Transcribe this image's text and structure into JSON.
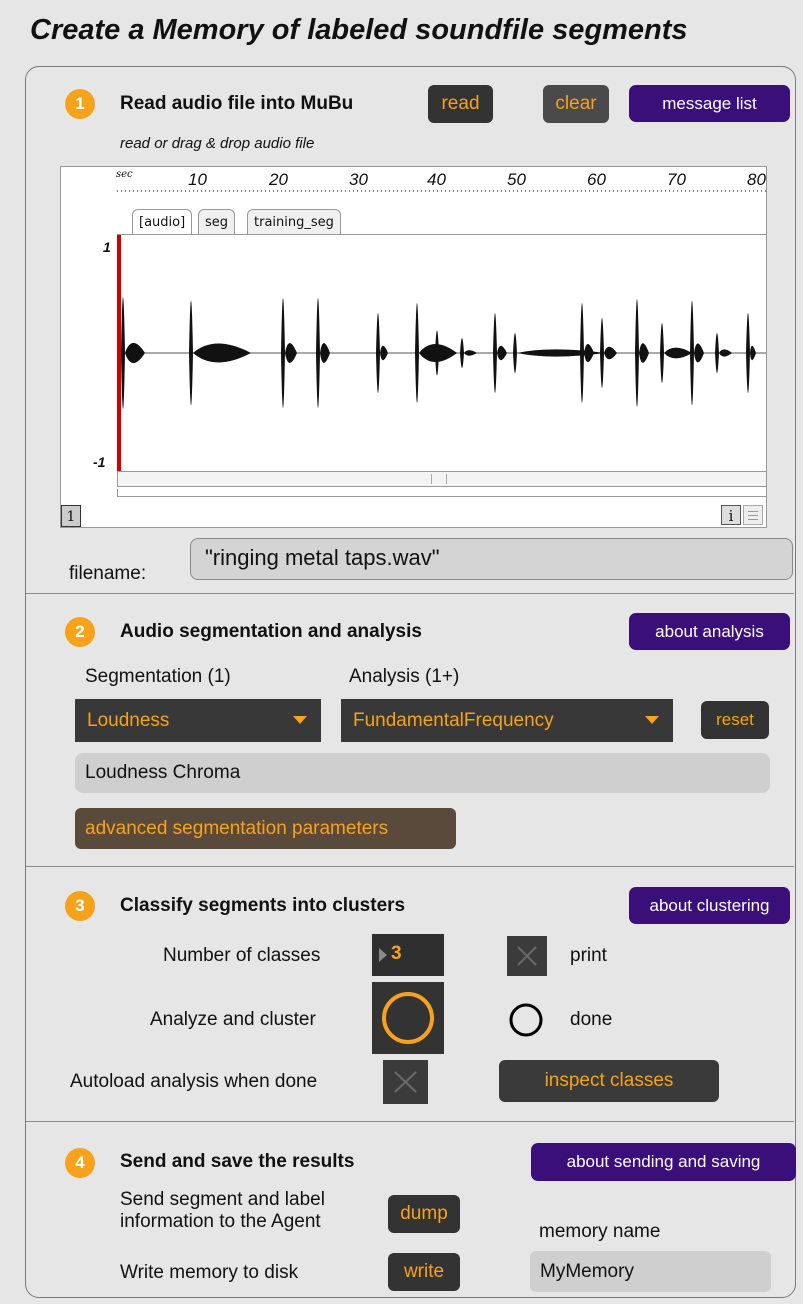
{
  "title": "Create a Memory of labeled soundfile segments",
  "section1": {
    "number": "1",
    "title": "Read audio file into MuBu",
    "read_label": "read",
    "clear_label": "clear",
    "message_list_label": "message list",
    "hint": "read or drag & drop audio file",
    "ruler_unit": "sec",
    "ruler_ticks": [
      "10",
      "20",
      "30",
      "40",
      "50",
      "60",
      "70",
      "80"
    ],
    "tabs": [
      "[audio]",
      "seg",
      "training_seg"
    ],
    "y_max_label": "1",
    "y_min_label": "-1",
    "track_index": "1",
    "info_icon_label": "i",
    "filename_label": "filename:",
    "filename_value": "\"ringing metal taps.wav\""
  },
  "section2": {
    "number": "2",
    "title": "Audio segmentation and analysis",
    "about_label": "about analysis",
    "segmentation_label": "Segmentation (1)",
    "analysis_label": "Analysis (1+)",
    "segmentation_value": "Loudness",
    "analysis_value": "FundamentalFrequency",
    "reset_label": "reset",
    "selected_analyses": "Loudness Chroma",
    "advanced_label": "advanced segmentation parameters"
  },
  "section3": {
    "number": "3",
    "title": "Classify segments into clusters",
    "about_label": "about clustering",
    "num_classes_label": "Number of classes",
    "num_classes_value": "3",
    "print_label": "print",
    "analyze_label": "Analyze and cluster",
    "done_label": "done",
    "autoload_label": "Autoload analysis when done",
    "inspect_label": "inspect classes"
  },
  "section4": {
    "number": "4",
    "title": "Send and save the results",
    "about_label": "about sending and saving",
    "send_label_line1": "Send segment and label",
    "send_label_line2": "information to the Agent",
    "dump_label": "dump",
    "memory_name_label": "memory name",
    "write_label_text": "Write memory to disk",
    "write_label": "write",
    "memory_name_value": "MyMemory"
  },
  "colors": {
    "accent": "#f7a21b",
    "purple": "#3a0f7a",
    "dark": "#333333",
    "playhead": "#d40000"
  }
}
